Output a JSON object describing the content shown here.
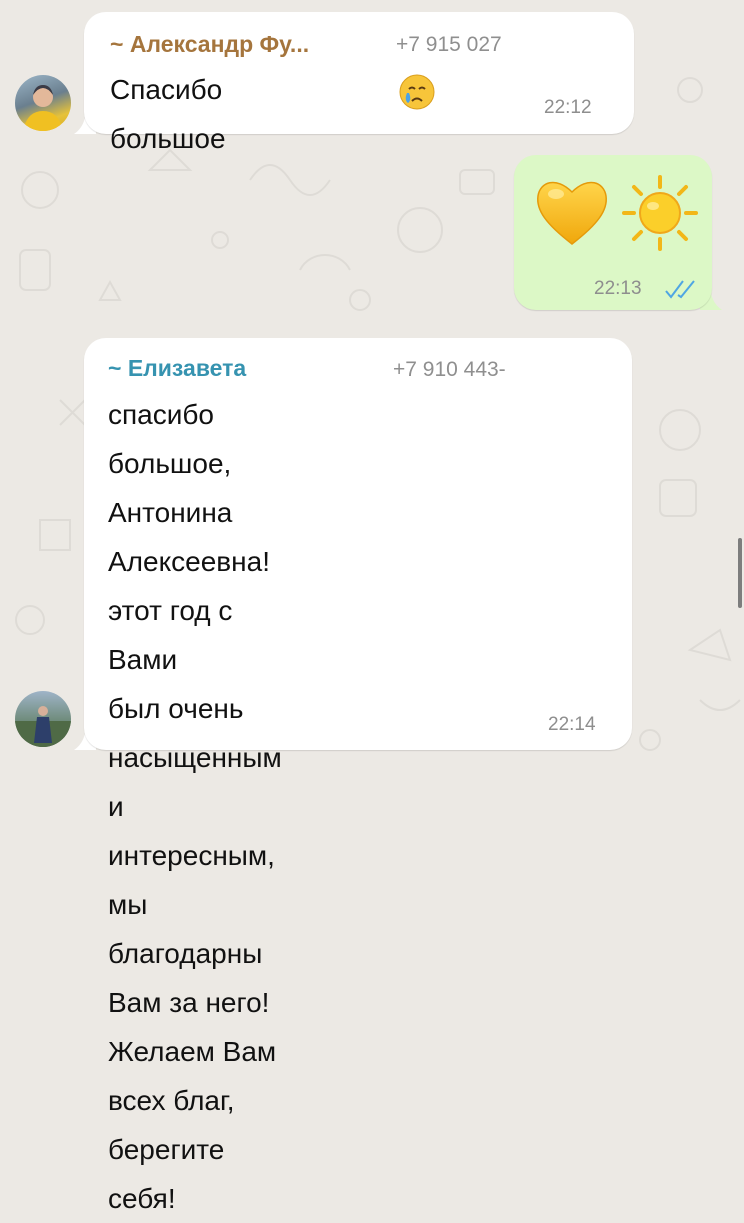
{
  "chat": {
    "messages": [
      {
        "sender": "~ Александр Фу...",
        "phone": "+7 915 027",
        "text": "Спасибо большое",
        "time": "22:12",
        "emoji": "crying-face-icon",
        "sender_color": "#a5753d"
      },
      {
        "time": "22:13",
        "emoji": [
          "yellow-heart-icon",
          "sun-icon"
        ],
        "status": "read-double-check-icon"
      },
      {
        "sender": "~ Елизавета",
        "phone": "+7 910 443-",
        "lines": [
          "спасибо большое, Антонина",
          "Алексеевна! этот год с Вами",
          "был очень насыщенным и",
          "интересным, мы благодарны",
          "Вам за него!",
          "Желаем Вам всех благ,",
          "берегите себя!"
        ],
        "time": "22:14",
        "sender_color": "#3693b0"
      }
    ]
  },
  "colors": {
    "background": "#ece9e4",
    "incoming_bubble": "#ffffff",
    "outgoing_bubble": "#dcf8c6",
    "read_ticks": "#4fa6e3"
  }
}
